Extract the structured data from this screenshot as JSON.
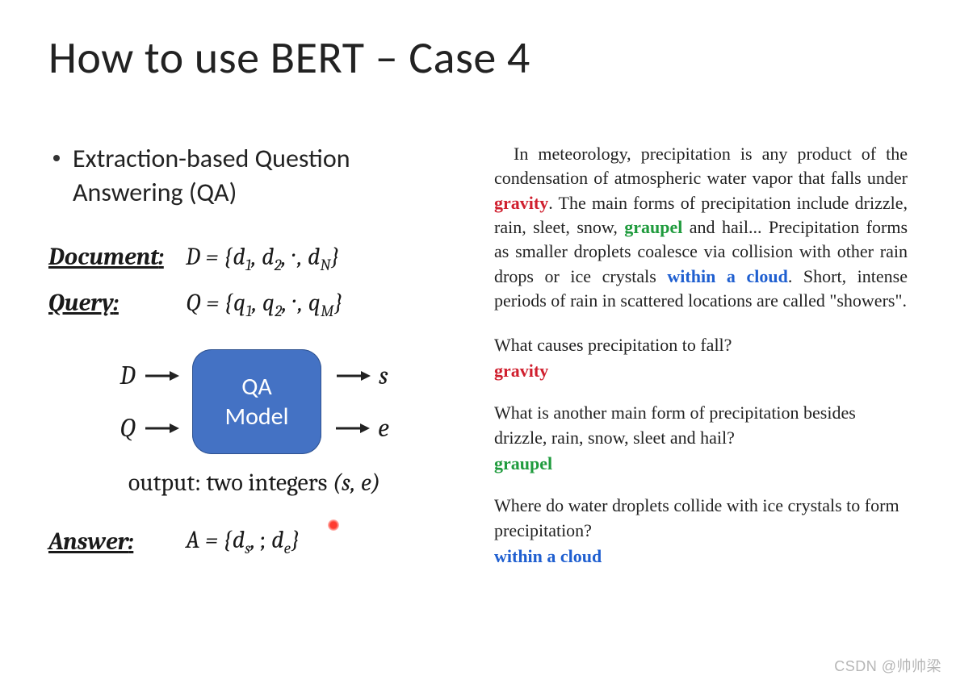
{
  "title": "How to use BERT – Case 4",
  "bullet": "Extraction-based Question Answering (QA)",
  "defs": {
    "document_label": "Document",
    "document_expr_html": "D = {d<sub class='ms'>1</sub>, d<sub class='ms'>2</sub>, ··· , d<sub class='ms'>N</sub>}",
    "query_label": "Query",
    "query_expr_html": "Q = {q<sub class='ms'>1</sub>, q<sub class='ms'>2</sub>, ··· , q<sub class='ms'>M</sub>}",
    "answer_label": "Answer",
    "answer_expr_html": "A = {d<sub class='ms'>s</sub>, ···, d<sub class='ms'>e</sub>}"
  },
  "diagram": {
    "in1": "D",
    "in2": "Q",
    "box_line1": "QA",
    "box_line2": "Model",
    "out1": "s",
    "out2": "e"
  },
  "output_line_prefix": "output: two integers ",
  "output_line_tuple": "(s, e)",
  "passage": {
    "p1": "In meteorology, precipitation is any product of the condensation of atmospheric water vapor that falls under ",
    "w_gravity": "gravity",
    "p2": ". The main forms of precipitation include drizzle, rain, sleet, snow, ",
    "w_graupel": "graupel",
    "p3": " and hail...  Precipitation forms as smaller droplets coalesce via collision with other rain drops or ice crystals ",
    "w_cloud": "within a cloud",
    "p4": ". Short, intense periods of rain in scattered locations are called \"showers\"."
  },
  "qa": [
    {
      "q": "What causes precipitation to fall?",
      "a": "gravity",
      "cls": "hl-red"
    },
    {
      "q": "What is another main form of precipitation besides drizzle, rain, snow, sleet and hail?",
      "a": "graupel",
      "cls": "hl-green"
    },
    {
      "q": "Where do water droplets collide with ice crystals to form precipitation?",
      "a": "within a cloud",
      "cls": "hl-blue"
    }
  ],
  "watermark": "CSDN @帅帅梁"
}
